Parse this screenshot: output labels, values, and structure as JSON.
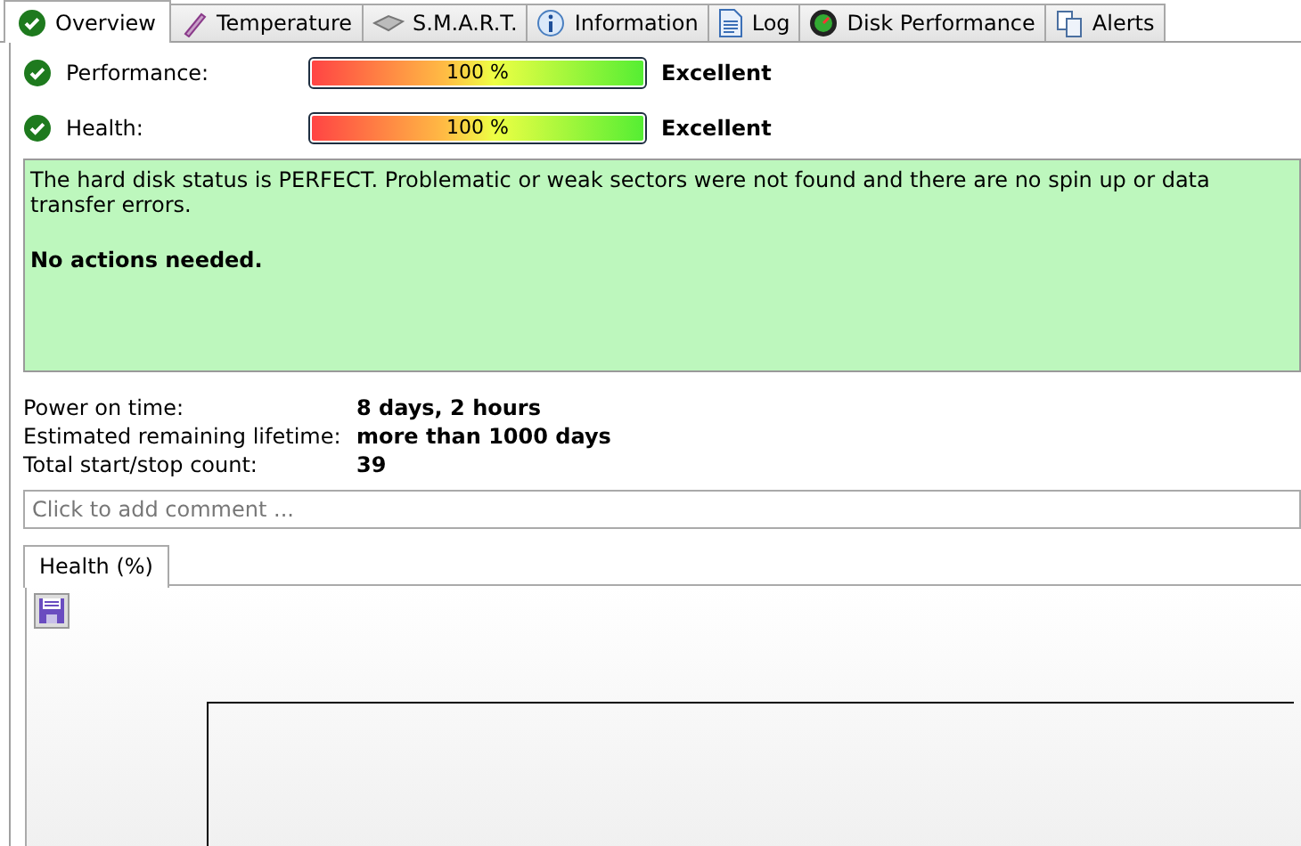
{
  "tabs": [
    {
      "label": "Overview",
      "kind": "check",
      "selected": true
    },
    {
      "label": "Temperature",
      "kind": "thermometer",
      "selected": false
    },
    {
      "label": "S.M.A.R.T.",
      "kind": "disk",
      "selected": false
    },
    {
      "label": "Information",
      "kind": "info",
      "selected": false
    },
    {
      "label": "Log",
      "kind": "document",
      "selected": false
    },
    {
      "label": "Disk Performance",
      "kind": "gauge",
      "selected": false
    },
    {
      "label": "Alerts",
      "kind": "copies",
      "selected": false
    }
  ],
  "ratings": [
    {
      "label": "Performance:",
      "level": 1,
      "reading": "100 %",
      "verdict": "Excellent"
    },
    {
      "label": "Health:",
      "level": 1,
      "reading": "100 %",
      "verdict": "Excellent"
    }
  ],
  "status": {
    "message": "The hard disk status is PERFECT. Problematic or weak sectors were not found and there are no spin up or data transfer errors.",
    "action": "No actions needed."
  },
  "details": [
    {
      "label": "Power on time:",
      "value": "8 days, 2 hours"
    },
    {
      "label": "Estimated remaining lifetime:",
      "value": "more than 1000 days"
    },
    {
      "label": "Total start/stop count:",
      "value": "39"
    }
  ],
  "comment": {
    "placeholder": "Click to add comment ..."
  },
  "chart_tabs": [
    {
      "label": "Health (%)",
      "selected": true
    }
  ]
}
